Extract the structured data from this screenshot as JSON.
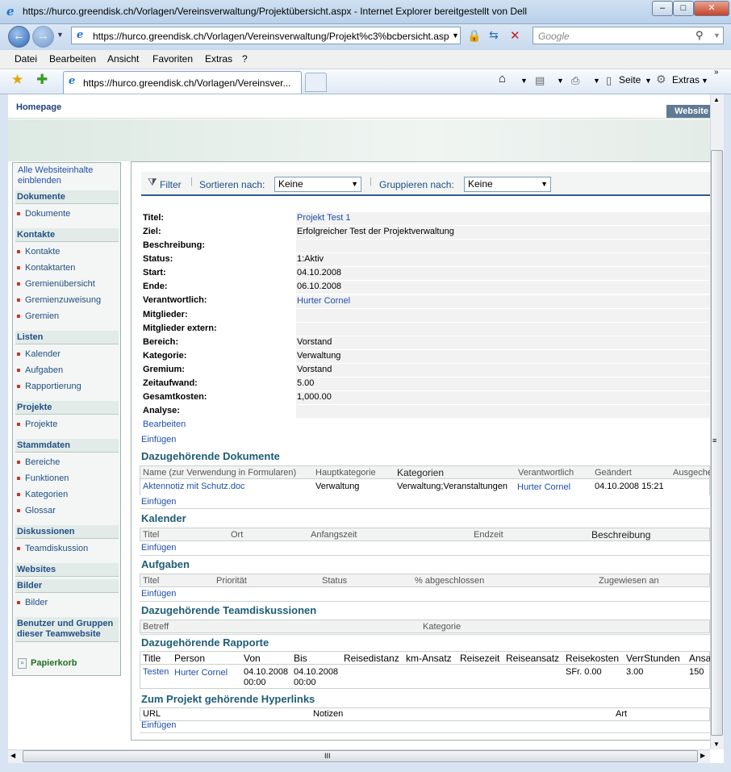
{
  "window": {
    "title": "https://hurco.greendisk.ch/Vorlagen/Vereinsverwaltung/Projektübersicht.aspx - Internet Explorer bereitgestellt von Dell",
    "address": "https://hurco.greendisk.ch/Vorlagen/Vereinsverwaltung/Projekt%c3%bcbersicht.asp",
    "search_placeholder": "Google",
    "tab_title": "https://hurco.greendisk.ch/Vorlagen/Vereinsver...",
    "menu": [
      "Datei",
      "Bearbeiten",
      "Ansicht",
      "Favoriten",
      "Extras",
      "?"
    ],
    "tools": {
      "page": "Seite",
      "extras": "Extras"
    }
  },
  "top": {
    "homepage": "Homepage",
    "website": "Website"
  },
  "leftnav": {
    "all_content": "Alle Websiteinhalte einblenden",
    "groups": [
      {
        "title": "Dokumente",
        "items": [
          "Dokumente"
        ]
      },
      {
        "title": "Kontakte",
        "items": [
          "Kontakte",
          "Kontaktarten",
          "Gremienübersicht",
          "Gremienzuweisung",
          "Gremien"
        ]
      },
      {
        "title": "Listen",
        "items": [
          "Kalender",
          "Aufgaben",
          "Rapportierung"
        ]
      },
      {
        "title": "Projekte",
        "items": [
          "Projekte"
        ]
      },
      {
        "title": "Stammdaten",
        "items": [
          "Bereiche",
          "Funktionen",
          "Kategorien",
          "Glossar"
        ]
      },
      {
        "title": "Diskussionen",
        "items": [
          "Teamdiskussion"
        ]
      },
      {
        "title": "Websites",
        "items": []
      },
      {
        "title": "Bilder",
        "items": [
          "Bilder"
        ]
      }
    ],
    "people": "Benutzer und Gruppen dieser Teamwebsite",
    "recycle": "Papierkorb"
  },
  "toolbar": {
    "filter": "Filter",
    "sort_label": "Sortieren nach:",
    "sort_value": "Keine",
    "group_label": "Gruppieren nach:",
    "group_value": "Keine"
  },
  "fields": [
    {
      "label": "Titel:",
      "value": "Projekt Test 1"
    },
    {
      "label": "Ziel:",
      "value": "Erfolgreicher Test der Projektverwaltung"
    },
    {
      "label": "Beschreibung:",
      "value": ""
    },
    {
      "label": "Status:",
      "value": "1:Aktiv"
    },
    {
      "label": "Start:",
      "value": "04.10.2008"
    },
    {
      "label": "Ende:",
      "value": "06.10.2008"
    },
    {
      "label": "Verantwortlich:",
      "value": "Hurter Cornel"
    },
    {
      "label": "Mitglieder:",
      "value": ""
    },
    {
      "label": "Mitglieder extern:",
      "value": ""
    },
    {
      "label": "Bereich:",
      "value": "Vorstand"
    },
    {
      "label": "Kategorie:",
      "value": "Verwaltung"
    },
    {
      "label": "Gremium:",
      "value": "Vorstand"
    },
    {
      "label": "Zeitaufwand:",
      "value": "5.00"
    },
    {
      "label": "Gesamtkosten:",
      "value": "1,000.00"
    },
    {
      "label": "Analyse:",
      "value": ""
    }
  ],
  "edit_link": "Bearbeiten",
  "insert_link": "Einfügen",
  "documents": {
    "title": "Dazugehörende Dokumente",
    "headers": [
      "Name (zur Verwendung in Formularen)",
      "Hauptkategorie",
      "Kategorien",
      "Verantwortlich",
      "Geändert",
      "Ausgeche"
    ],
    "row": [
      "Aktennotiz mit Schutz.doc",
      "Verwaltung",
      "Verwaltung;Veranstaltungen",
      "Hurter Cornel",
      "04.10.2008 15:21",
      ""
    ],
    "insert": "Einfügen"
  },
  "calendar": {
    "title": "Kalender",
    "headers": [
      "Titel",
      "Ort",
      "Anfangszeit",
      "Endzeit",
      "Beschreibung"
    ],
    "insert": "Einfügen"
  },
  "tasks": {
    "title": "Aufgaben",
    "headers": [
      "Titel",
      "Priorität",
      "Status",
      "% abgeschlossen",
      "Zugewiesen an"
    ],
    "insert": "Einfügen"
  },
  "discussions": {
    "title": "Dazugehörende Teamdiskussionen",
    "headers": [
      "Betreff",
      "Kategorie"
    ]
  },
  "reports": {
    "title": "Dazugehörende Rapporte",
    "headers": [
      "Title",
      "Person",
      "Von",
      "Bis",
      "Reisedistanz",
      "km-Ansatz",
      "Reisezeit",
      "Reiseansatz",
      "Reisekosten",
      "VerrStunden",
      "Ansa"
    ],
    "row": {
      "title": "Testen",
      "person": "Hurter Cornel",
      "von_date": "04.10.2008",
      "von_time": "00:00",
      "bis_date": "04.10.2008",
      "bis_time": "00:00",
      "reisekosten": "SFr. 0.00",
      "verrstunden": "3.00",
      "ansatz": "150"
    }
  },
  "hyperlinks": {
    "title": "Zum Projekt gehörende Hyperlinks",
    "headers": [
      "URL",
      "Notizen",
      "Art"
    ],
    "insert": "Einfügen"
  },
  "scroll_h_label": "III"
}
